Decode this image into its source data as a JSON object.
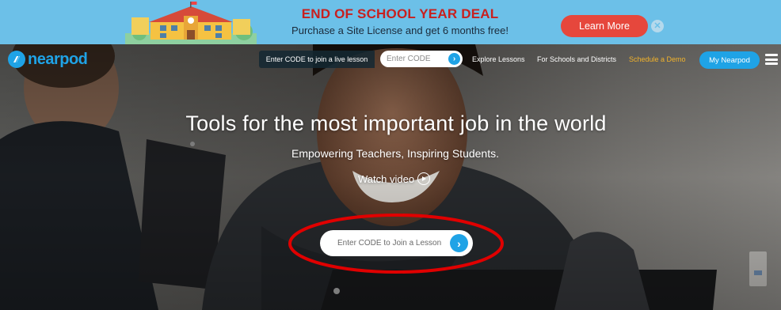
{
  "banner": {
    "title": "END OF SCHOOL YEAR DEAL",
    "subtitle": "Purchase a Site License and get 6 months free!",
    "cta": "Learn More",
    "close_icon": "close-icon",
    "illustration": "school-building-icon"
  },
  "nav": {
    "logo_text": "nearpod",
    "code_prompt": "Enter CODE to join a live lesson",
    "code_placeholder": "Enter CODE",
    "links": {
      "explore": "Explore Lessons",
      "schools": "For Schools and Districts",
      "demo": "Schedule a Demo"
    },
    "my_button": "My Nearpod",
    "menu_icon": "hamburger-menu-icon"
  },
  "hero": {
    "headline": "Tools for the most important job in the world",
    "subhead": "Empowering Teachers, Inspiring Students.",
    "watch_label": "Watch video",
    "join_label": "Enter CODE to Join a Lesson"
  },
  "colors": {
    "banner_bg": "#6cc0e8",
    "deal_red": "#c8201f",
    "learn_btn": "#e6473c",
    "brand_blue": "#1fa3e6",
    "demo_yellow": "#f2b32b",
    "annotation_red": "#e00000"
  }
}
